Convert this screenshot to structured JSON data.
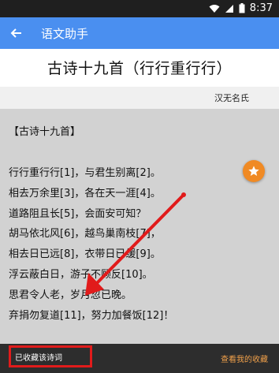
{
  "status": {
    "time": "8:37"
  },
  "appbar": {
    "title": "语文助手"
  },
  "poem": {
    "title": "古诗十九首（行行重行行）",
    "author": "汉无名氏",
    "section_title": "【古诗十九首】",
    "lines": [
      "行行重行行[1]，与君生别离[2]。",
      "相去万余里[3]，各在天一涯[4]。",
      "道路阻且长[5]，会面安可知？",
      "胡马依北风[6]，越鸟巢南枝[7]，",
      "相去日已远[8]，衣带日已缓[9]。",
      "浮云蔽白日，游子不顾反[10]。",
      "思君令人老，岁月忽已晚。",
      "弃捐勿复道[11]，努力加餐饭[12]！"
    ]
  },
  "bottom": {
    "collected_label": "已收藏该诗词",
    "my_collection_label": "查看我的收藏"
  },
  "icons": {
    "back": "back-arrow-icon",
    "fab": "star-icon",
    "wifi": "wifi-icon",
    "signal": "signal-icon",
    "battery": "battery-icon"
  },
  "colors": {
    "appbar": "#4a8ff0",
    "fab": "#f08a24",
    "annotation": "#e11b1b",
    "my_collection": "#f0a04a"
  }
}
